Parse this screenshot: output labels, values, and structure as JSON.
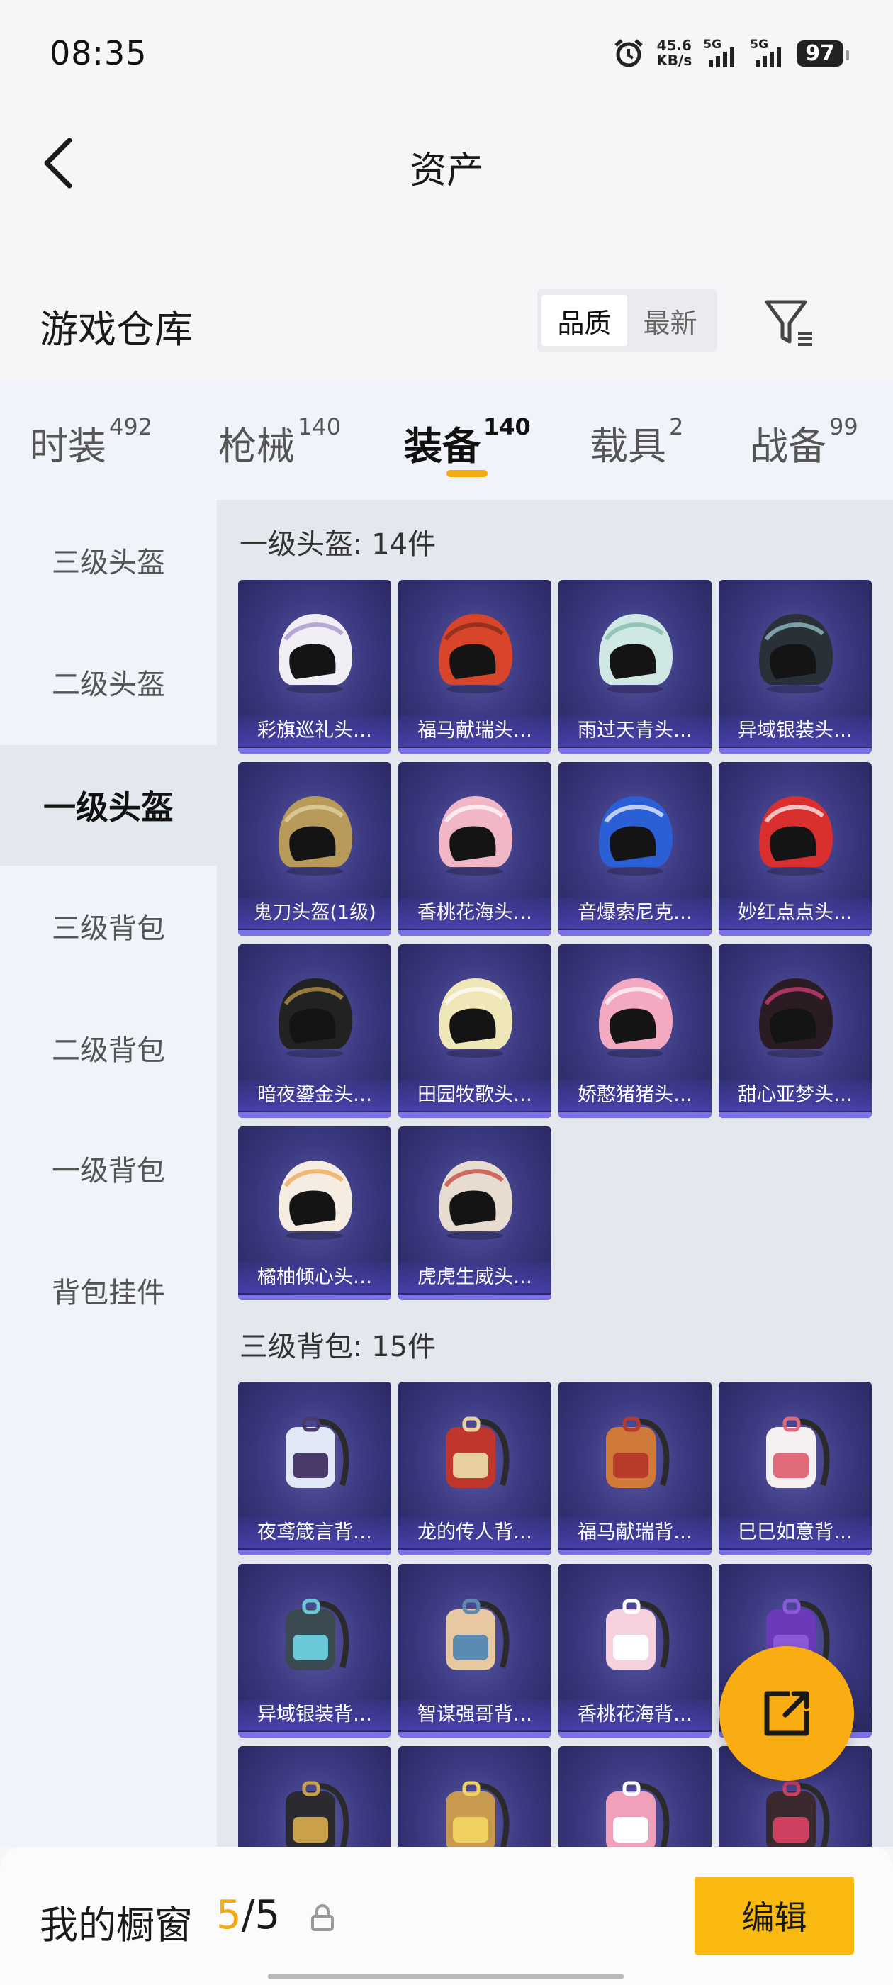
{
  "status_bar": {
    "time": "08:35",
    "net_speed_value": "45.6",
    "net_speed_unit": "KB/s",
    "sim1": "5G",
    "sim2": "5G",
    "battery": "97",
    "icons": [
      "alarm-icon",
      "signal-icon",
      "signal-icon"
    ]
  },
  "header": {
    "title": "资产",
    "back_icon": "chevron-left-icon"
  },
  "warehouse": {
    "title": "游戏仓库",
    "sort_options": [
      "品质",
      "最新"
    ],
    "sort_selected": "品质",
    "filter_icon": "filter-icon"
  },
  "tabs": [
    {
      "label": "时装",
      "count": "492"
    },
    {
      "label": "枪械",
      "count": "140"
    },
    {
      "label": "装备",
      "count": "140",
      "active": true
    },
    {
      "label": "载具",
      "count": "2"
    },
    {
      "label": "战备",
      "count": "99"
    }
  ],
  "sidebar": {
    "items": [
      {
        "label": "三级头盔"
      },
      {
        "label": "二级头盔"
      },
      {
        "label": "一级头盔",
        "active": true
      },
      {
        "label": "三级背包"
      },
      {
        "label": "二级背包"
      },
      {
        "label": "一级背包"
      },
      {
        "label": "背包挂件"
      }
    ]
  },
  "sections": [
    {
      "title": "一级头盔: 14件",
      "items": [
        "彩旗巡礼头…",
        "福马献瑞头…",
        "雨过天青头…",
        "异域银装头…",
        "鬼刀头盔(1级)",
        "香桃花海头…",
        "音爆索尼克…",
        "妙红点点头…",
        "暗夜鎏金头…",
        "田园牧歌头…",
        "娇憨猪猪头…",
        "甜心亚梦头…",
        "橘柚倾心头…",
        "虎虎生威头…"
      ]
    },
    {
      "title": "三级背包: 15件",
      "items": [
        "夜鸢箴言背…",
        "龙的传人背…",
        "福马献瑞背…",
        "巳巳如意背…",
        "异域银装背…",
        "智谋强哥背…",
        "香桃花海背…",
        "",
        "",
        "",
        "",
        ""
      ]
    }
  ],
  "colors": {
    "accent": "#f4ab13",
    "button": "#f9b911",
    "card_bg": "#3c3a82"
  },
  "showcase": {
    "label": "我的橱窗",
    "current": "5",
    "separator": "/",
    "total": "5",
    "lock_icon": "lock-icon"
  },
  "edit_button": {
    "label": "编辑"
  },
  "fab": {
    "icon": "share-icon"
  }
}
